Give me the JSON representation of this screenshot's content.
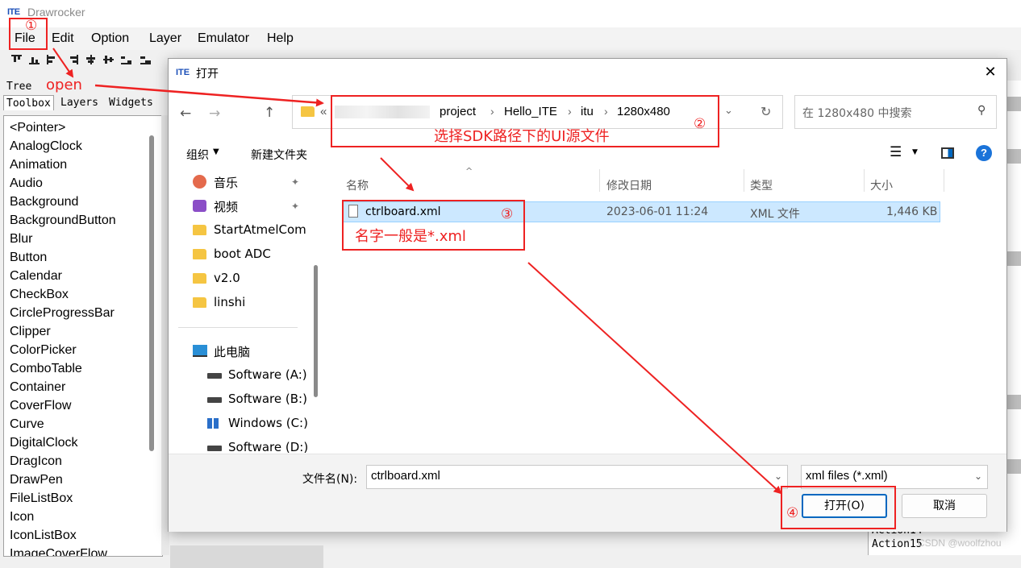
{
  "app": {
    "title": "Drawrocker",
    "logo": "ITE",
    "menu": [
      "File",
      "Edit",
      "Option",
      "Layer",
      "Emulator",
      "Help"
    ],
    "tree_label": "Tree",
    "tabs": [
      "Toolbox",
      "Layers",
      "Widgets"
    ],
    "toolbox_items": [
      "<Pointer>",
      "AnalogClock",
      "Animation",
      "Audio",
      "Background",
      "BackgroundButton",
      "Blur",
      "Button",
      "Calendar",
      "CheckBox",
      "CircleProgressBar",
      "Clipper",
      "ColorPicker",
      "ComboTable",
      "Container",
      "CoverFlow",
      "Curve",
      "DigitalClock",
      "DragIcon",
      "DrawPen",
      "FileListBox",
      "Icon",
      "IconListBox",
      "ImageCoverFlow"
    ],
    "bottom_lines": [
      "Action14",
      "Action15"
    ]
  },
  "dialog": {
    "logo": "ITE",
    "title": "打开",
    "close_glyph": "✕",
    "nav": {
      "back": "←",
      "forward": "→",
      "up": "↑"
    },
    "breadcrumb": {
      "prefix": "«",
      "items": [
        "project",
        "Hello_ITE",
        "itu",
        "1280x480"
      ],
      "separator": "›"
    },
    "search_placeholder": "在 1280x480 中搜索",
    "organize": "组织",
    "new_folder": "新建文件夹",
    "sidebar": {
      "quick": [
        "音乐",
        "视频",
        "StartAtmelCom",
        "boot ADC",
        "v2.0",
        "linshi"
      ],
      "this_pc": "此电脑",
      "drives": [
        "Software (A:)",
        "Software (B:)",
        "Windows (C:)",
        "Software (D:)"
      ]
    },
    "columns": {
      "name": "名称",
      "modified": "修改日期",
      "type": "类型",
      "size": "大小"
    },
    "files": [
      {
        "name": "ctrlboard.xml",
        "modified": "2023-06-01 11:24",
        "type": "XML 文件",
        "size": "1,446 KB"
      }
    ],
    "filename_label": "文件名(N):",
    "filename_value": "ctrlboard.xml",
    "filetype_value": "xml files (*.xml)",
    "open_button": "打开(O)",
    "cancel_button": "取消"
  },
  "annotations": {
    "step1": "①",
    "open_text": "open",
    "step2": "②",
    "step2_text": "选择SDK路径下的UI源文件",
    "step3": "③",
    "step3_text": "名字一般是*.xml",
    "step4": "④"
  },
  "watermark": "CSDN @woolfzhou",
  "colors": {
    "annotation": "#ee2222",
    "selection": "#cce8ff",
    "accent": "#0067c0",
    "folder": "#f5c542"
  }
}
